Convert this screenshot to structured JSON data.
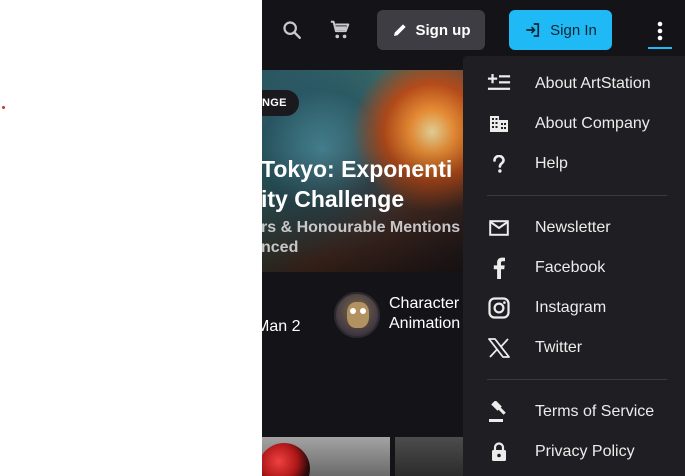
{
  "header": {
    "signup_label": "Sign up",
    "signin_label": "Sign In",
    "accent_color": "#1fbaf5"
  },
  "hero": {
    "badge": "NGE",
    "title_line1": "Tokyo: Exponenti",
    "title_line2": "ity Challenge",
    "subtitle_line1": "rs & Honourable Mentions",
    "subtitle_line2": "nced"
  },
  "cards": {
    "left_text": "Man 2",
    "right_line1": "Character",
    "right_line2": "Animation"
  },
  "menu": {
    "items": [
      {
        "label": "About ArtStation",
        "icon": "about-artstation-icon"
      },
      {
        "label": "About Company",
        "icon": "company-building-icon"
      },
      {
        "label": "Help",
        "icon": "help-question-icon"
      },
      {
        "label": "Newsletter",
        "icon": "mail-icon"
      },
      {
        "label": "Facebook",
        "icon": "facebook-icon"
      },
      {
        "label": "Instagram",
        "icon": "instagram-icon"
      },
      {
        "label": "Twitter",
        "icon": "x-twitter-icon"
      },
      {
        "label": "Terms of Service",
        "icon": "gavel-icon"
      },
      {
        "label": "Privacy Policy",
        "icon": "lock-icon"
      }
    ]
  }
}
